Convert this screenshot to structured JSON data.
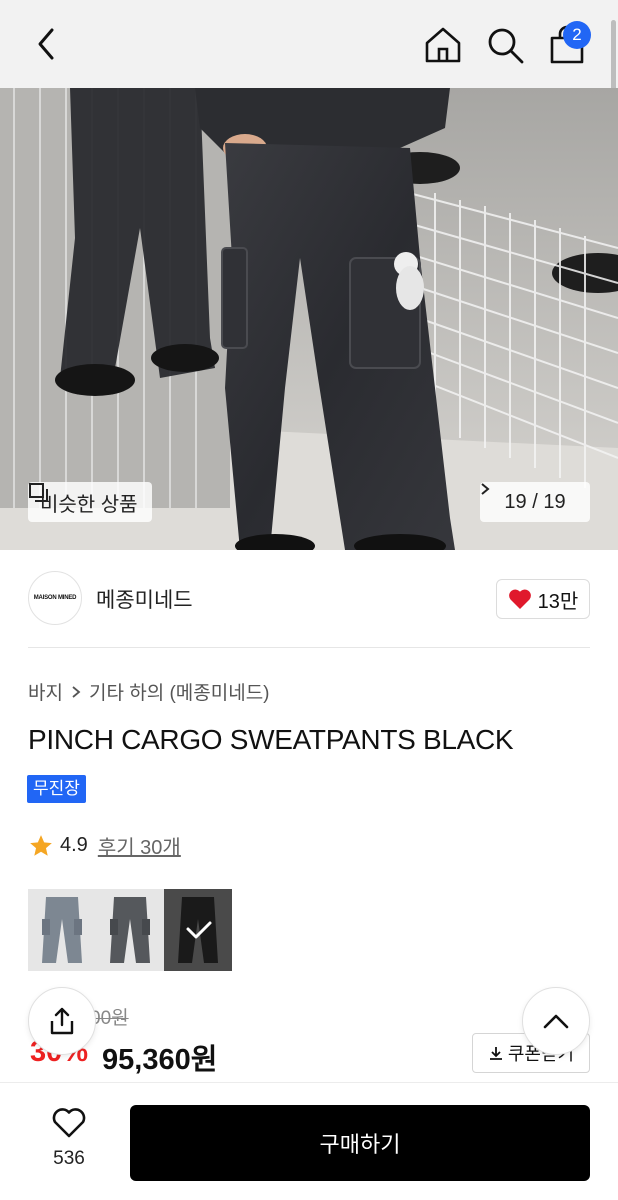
{
  "header": {
    "cart_count": "2"
  },
  "gallery": {
    "similar_label": "비슷한 상품",
    "counter": "19 / 19"
  },
  "brand": {
    "logo_text": "MAISON MINED",
    "name": "메종미네드",
    "likes": "13만"
  },
  "breadcrumb": {
    "category": "바지",
    "subcategory": "기타 하의 (메종미네드)"
  },
  "product": {
    "title": "PINCH CARGO SWEATPANTS BLACK",
    "tag": "무진장",
    "rating": "4.9",
    "reviews": "후기 30개",
    "color_options": [
      {
        "name": "grey-blue",
        "color": "#7d8792"
      },
      {
        "name": "charcoal",
        "color": "#55585c"
      },
      {
        "name": "black",
        "color": "#1a1a1a",
        "selected": true
      }
    ]
  },
  "pricing": {
    "original_price": "00원",
    "discount": "30%",
    "price": "95,360원",
    "coupon_label": "쿠폰받기"
  },
  "bottom_bar": {
    "wish_count": "536",
    "buy_label": "구매하기"
  },
  "colors": {
    "accent": "#2166f5",
    "discount_red": "#e22222",
    "heart_red": "#e0192c",
    "buy_bg": "#000000"
  }
}
